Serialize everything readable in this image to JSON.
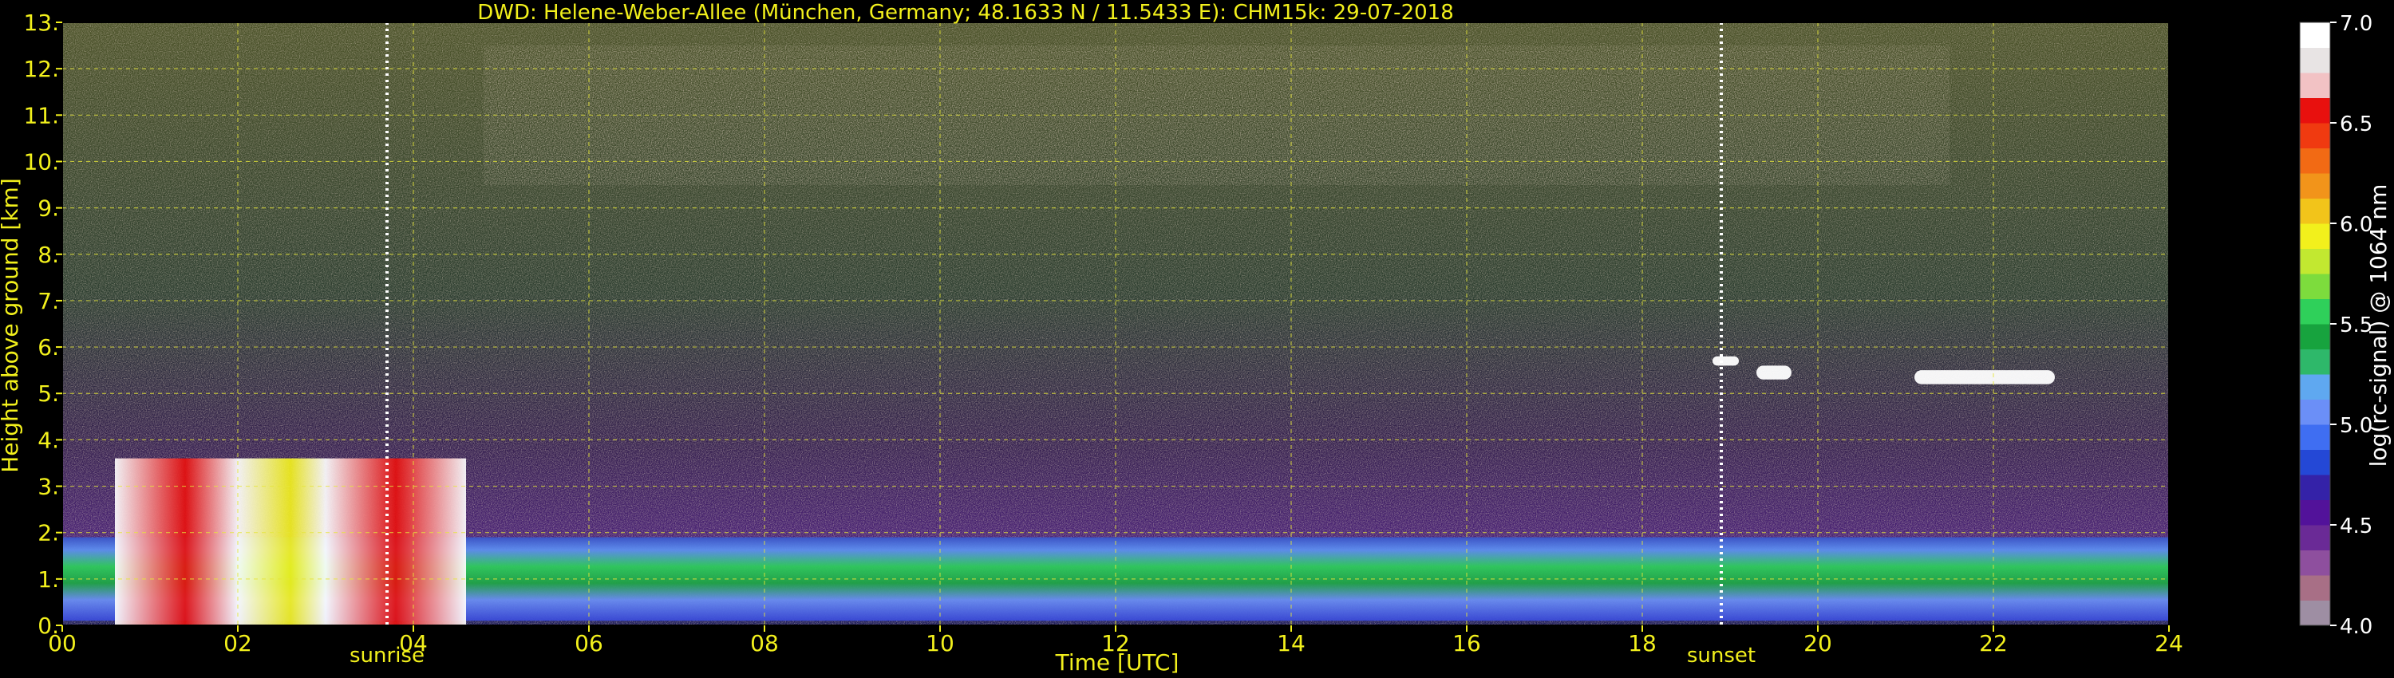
{
  "chart_data": {
    "type": "heatmap",
    "title": "DWD: Helene-Weber-Allee (München, Germany; 48.1633 N / 11.5433 E):    CHM15k: 29-07-2018",
    "xlabel": "Time [UTC]",
    "ylabel": "Height above ground [km]",
    "xlim": [
      0,
      24
    ],
    "ylim": [
      0,
      13
    ],
    "x_ticks": [
      0,
      2,
      4,
      6,
      8,
      10,
      12,
      14,
      16,
      18,
      20,
      22,
      24
    ],
    "x_tick_labels": [
      "00",
      "02",
      "04",
      "06",
      "08",
      "10",
      "12",
      "14",
      "16",
      "18",
      "20",
      "22",
      "24"
    ],
    "y_ticks": [
      0,
      1,
      2,
      3,
      4,
      5,
      6,
      7,
      8,
      9,
      10,
      11,
      12,
      13
    ],
    "y_tick_labels": [
      "0.",
      "1.",
      "2.",
      "3.",
      "4.",
      "5.",
      "6.",
      "7.",
      "8.",
      "9.",
      "10.",
      "11.",
      "12.",
      "13."
    ],
    "grid": true,
    "markers": [
      {
        "label": "sunrise",
        "x": 3.7
      },
      {
        "label": "sunset",
        "x": 18.9
      }
    ],
    "colorbar": {
      "label": "log(rc-signal) @ 1064 nm",
      "range": [
        4.0,
        7.0
      ],
      "tick_values": [
        4.0,
        4.5,
        5.0,
        5.5,
        6.0,
        6.5,
        7.0
      ],
      "tick_labels": [
        "4.0",
        "4.5",
        "5.0",
        "5.5",
        "6.0",
        "6.5",
        "7.0"
      ],
      "colors": [
        "#9e8ea3",
        "#a86f86",
        "#8e4f9e",
        "#6a2a96",
        "#52129a",
        "#3422a8",
        "#2448d6",
        "#3f6ef2",
        "#6b8ff7",
        "#5fa8f0",
        "#2eb86a",
        "#17a33e",
        "#2fd05a",
        "#7ddc3d",
        "#c2e830",
        "#f2f01c",
        "#f2c41a",
        "#f2941a",
        "#f26a14",
        "#f03a10",
        "#e8100e",
        "#f2c2c4",
        "#e8e4e4",
        "#ffffff"
      ]
    },
    "features": [
      {
        "name": "boundary-layer-aerosol",
        "x0": 0,
        "x1": 24,
        "y0": 0.1,
        "y1": 1.9,
        "level": 5.2
      },
      {
        "name": "low-cloud",
        "x0": 0.6,
        "x1": 4.6,
        "y0": 0,
        "y1": 3.6,
        "level": 7.0
      },
      {
        "name": "cirrus-band",
        "x0": 4.8,
        "x1": 21.5,
        "y0": 9.5,
        "y1": 12.5,
        "level": 6.6
      },
      {
        "name": "mid-cloud-1",
        "x0": 18.8,
        "x1": 19.1,
        "y0": 5.6,
        "y1": 5.8,
        "level": 6.8
      },
      {
        "name": "mid-cloud-2",
        "x0": 19.3,
        "x1": 19.7,
        "y0": 5.3,
        "y1": 5.6,
        "level": 6.8
      },
      {
        "name": "mid-cloud-3",
        "x0": 21.1,
        "x1": 22.7,
        "y0": 5.2,
        "y1": 5.5,
        "level": 6.8
      }
    ]
  }
}
